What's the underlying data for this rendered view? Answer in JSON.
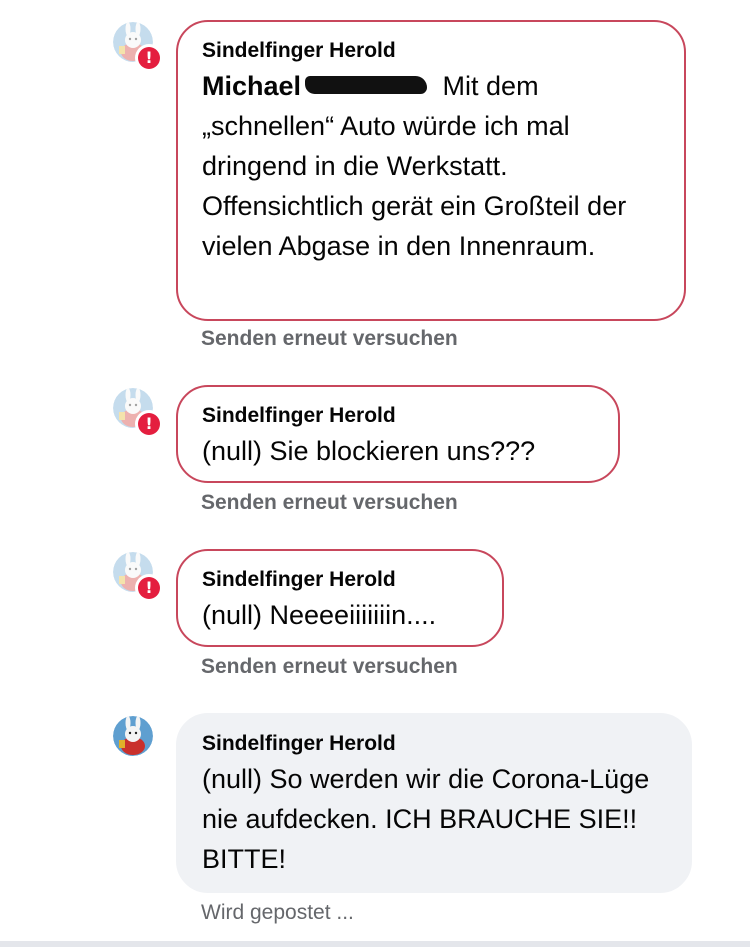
{
  "comments": [
    {
      "author": "Sindelfinger Herold",
      "mention": "Michael",
      "text": " Mit dem „schnellen“ Auto würde ich mal dringend in die Werkstatt. Offensichtlich gerät ein Großteil der vielen Abgase in den Innenraum.",
      "status": "Senden erneut versuchen",
      "state": "failed"
    },
    {
      "author": "Sindelfinger Herold",
      "text": "(null) Sie blockieren uns???",
      "status": "Senden erneut versuchen",
      "state": "failed"
    },
    {
      "author": "Sindelfinger Herold",
      "text": "(null) Neeeeiiiiiiin....",
      "status": "Senden erneut versuchen",
      "state": "failed"
    },
    {
      "author": "Sindelfinger Herold",
      "text": "(null) So werden wir die Corona-Lüge nie aufdecken. ICH BRAUCHE SIE!! BITTE!",
      "status": "Wird gepostet ...",
      "state": "posting"
    }
  ],
  "icons": {
    "error": "error-icon",
    "avatar": "rabbit-avatar"
  },
  "colors": {
    "error_border": "#c8475c",
    "error_badge": "#e41e3f",
    "bubble_bg": "#f0f2f5",
    "status_text": "#65676b"
  }
}
